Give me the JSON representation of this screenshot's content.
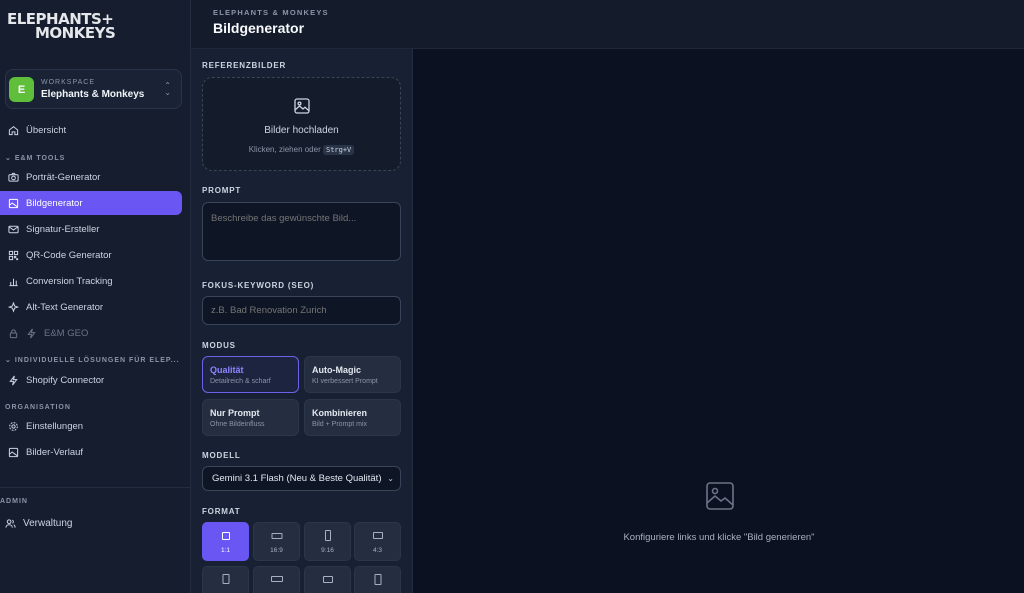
{
  "brand": {
    "logo_line1": "ELEPHANTS+",
    "logo_line2": "MONKEYS"
  },
  "workspace": {
    "kicker": "WORKSPACE",
    "name": "Elephants & Monkeys",
    "avatar": "E",
    "avatar_color": "#5fbf3b"
  },
  "nav": {
    "overview": "Übersicht",
    "section_tools": "E&M TOOLS",
    "tools": [
      {
        "label": "Porträt-Generator",
        "icon": "camera-icon"
      },
      {
        "label": "Bildgenerator",
        "icon": "image-icon",
        "active": true
      },
      {
        "label": "Signatur-Ersteller",
        "icon": "mail-icon"
      },
      {
        "label": "QR-Code Generator",
        "icon": "qr-icon"
      },
      {
        "label": "Conversion Tracking",
        "icon": "bar-chart-icon"
      },
      {
        "label": "Alt-Text Generator",
        "icon": "sparkle-icon"
      },
      {
        "label": "E&M GEO",
        "icon": "bolt-icon",
        "locked": true
      }
    ],
    "section_custom": "INDIVIDUELLE LÖSUNGEN FÜR ELEP...",
    "custom": [
      {
        "label": "Shopify Connector",
        "icon": "bolt-icon"
      }
    ],
    "section_org": "ORGANISATION",
    "org": [
      {
        "label": "Einstellungen",
        "icon": "gear-icon"
      },
      {
        "label": "Bilder-Verlauf",
        "icon": "image-icon"
      }
    ],
    "section_admin": "ADMIN",
    "admin": [
      {
        "label": "Verwaltung",
        "icon": "users-icon"
      }
    ]
  },
  "header": {
    "breadcrumb": "ELEPHANTS & MONKEYS",
    "title": "Bildgenerator"
  },
  "panel": {
    "ref_label": "REFERENZBILDER",
    "upload_title": "Bilder hochladen",
    "upload_hint": "Klicken, ziehen oder",
    "upload_kbd": "Strg+V",
    "prompt_label": "PROMPT",
    "prompt_placeholder": "Beschreibe das gewünschte Bild...",
    "keyword_label": "FOKUS-KEYWORD (SEO)",
    "keyword_placeholder": "z.B. Bad Renovation Zurich",
    "mode_label": "MODUS",
    "modes": [
      {
        "title": "Qualität",
        "sub": "Detailreich & scharf",
        "selected": true
      },
      {
        "title": "Auto-Magic",
        "sub": "KI verbessert Prompt"
      },
      {
        "title": "Nur Prompt",
        "sub": "Ohne Bildeinfluss"
      },
      {
        "title": "Kombinieren",
        "sub": "Bild + Prompt mix"
      }
    ],
    "model_label": "MODELL",
    "model_value": "Gemini 3.1 Flash (Neu & Beste Qualität)",
    "format_label": "FORMAT",
    "formats": [
      {
        "label": "1:1",
        "selected": true
      },
      {
        "label": "16:9"
      },
      {
        "label": "9:16"
      },
      {
        "label": "4:3"
      }
    ]
  },
  "preview": {
    "hint": "Konfiguriere links und klicke \"Bild generieren\""
  },
  "colors": {
    "accent": "#6a56f2",
    "sidebar_bg": "#151d2e",
    "panel_bg": "#182133",
    "preview_bg": "#0b1120"
  }
}
